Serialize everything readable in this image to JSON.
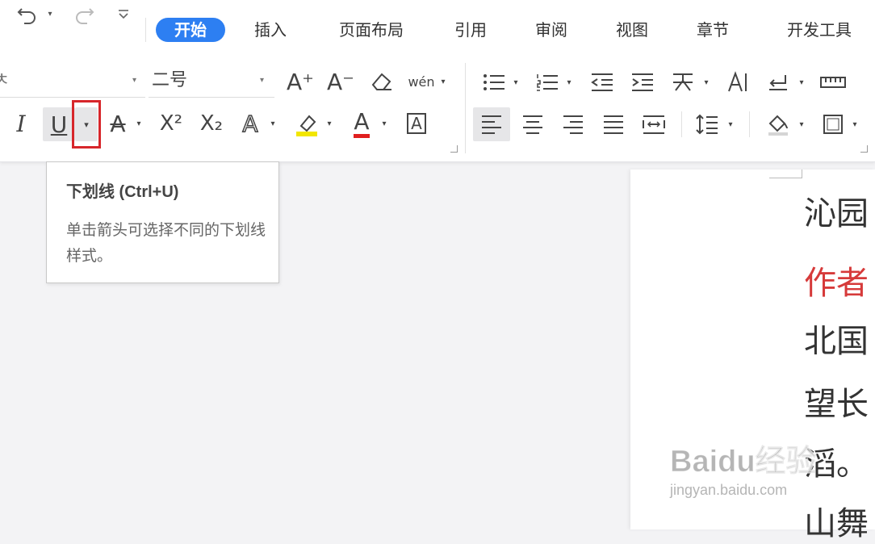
{
  "qat": {
    "undo_icon": "undo-icon",
    "redo_icon": "redo-icon",
    "customize_icon": "customize-qat-icon"
  },
  "tabs": [
    {
      "label": "开始",
      "active": true
    },
    {
      "label": "插入"
    },
    {
      "label": "页面布局"
    },
    {
      "label": "引用"
    },
    {
      "label": "审阅"
    },
    {
      "label": "视图"
    },
    {
      "label": "章节"
    },
    {
      "label": "开发工具"
    }
  ],
  "font": {
    "name_partial": "ㅊ",
    "size": "二号"
  },
  "toolbar": {
    "grow_font": "A⁺",
    "shrink_font": "A⁻",
    "pinyin": "wén",
    "italic": "I",
    "underline": "U",
    "strike": "A",
    "superscript": "X²",
    "subscript": "X₂",
    "text_effect": "A",
    "font_color": "A",
    "char_border": "A"
  },
  "colors": {
    "accent": "#2d7ff2",
    "highlight_red": "#d7262b",
    "highlight_yellow": "#f2e600",
    "font_color_red": "#e02020"
  },
  "tooltip": {
    "title": "下划线 (Ctrl+U)",
    "desc": "单击箭头可选择不同的下划线样式。"
  },
  "document": {
    "lines": [
      {
        "text": "沁园",
        "color": "#333333"
      },
      {
        "text": "作者",
        "color": "#d63a3a"
      },
      {
        "text": "北国",
        "color": "#333333"
      },
      {
        "text": "望长",
        "color": "#333333"
      },
      {
        "text": "滔。",
        "color": "#333333"
      },
      {
        "text": "山舞",
        "color": "#333333"
      }
    ]
  },
  "watermark": {
    "brand": "Baidu经验",
    "url": "jingyan.baidu.com"
  }
}
